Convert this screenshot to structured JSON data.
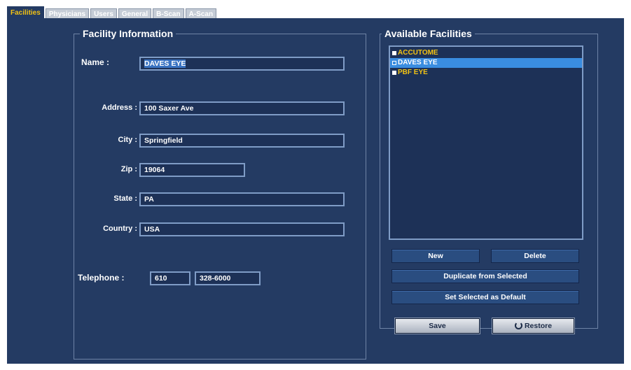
{
  "tabs": [
    {
      "label": "Facilities",
      "active": true
    },
    {
      "label": "Physicians",
      "active": false
    },
    {
      "label": "Users",
      "active": false
    },
    {
      "label": "General",
      "active": false
    },
    {
      "label": "B-Scan",
      "active": false
    },
    {
      "label": "A-Scan",
      "active": false
    }
  ],
  "facility_info": {
    "title": "Facility Information",
    "name_label": "Name :",
    "name_value": "DAVES EYE",
    "address_label": "Address :",
    "address_value": "100 Saxer Ave",
    "city_label": "City :",
    "city_value": "Springfield",
    "zip_label": "Zip :",
    "zip_value": "19064",
    "state_label": "State :",
    "state_value": "PA",
    "country_label": "Country :",
    "country_value": "USA",
    "telephone_label": "Telephone :",
    "telephone_area": "610",
    "telephone_number": "328-6000"
  },
  "available": {
    "title": "Available Facilities",
    "items": [
      {
        "label": "ACCUTOME",
        "selected": false
      },
      {
        "label": "DAVES EYE",
        "selected": true
      },
      {
        "label": "PBF EYE",
        "selected": false
      }
    ],
    "new_label": "New",
    "delete_label": "Delete",
    "duplicate_label": "Duplicate from Selected",
    "set_default_label": "Set Selected as Default"
  },
  "actions": {
    "save_label": "Save",
    "restore_label": "Restore"
  },
  "colors": {
    "panel_bg": "#243b63",
    "active_tab_text": "#f2c214",
    "list_text": "#f2c214",
    "list_selected_bg": "#3a8de0"
  }
}
